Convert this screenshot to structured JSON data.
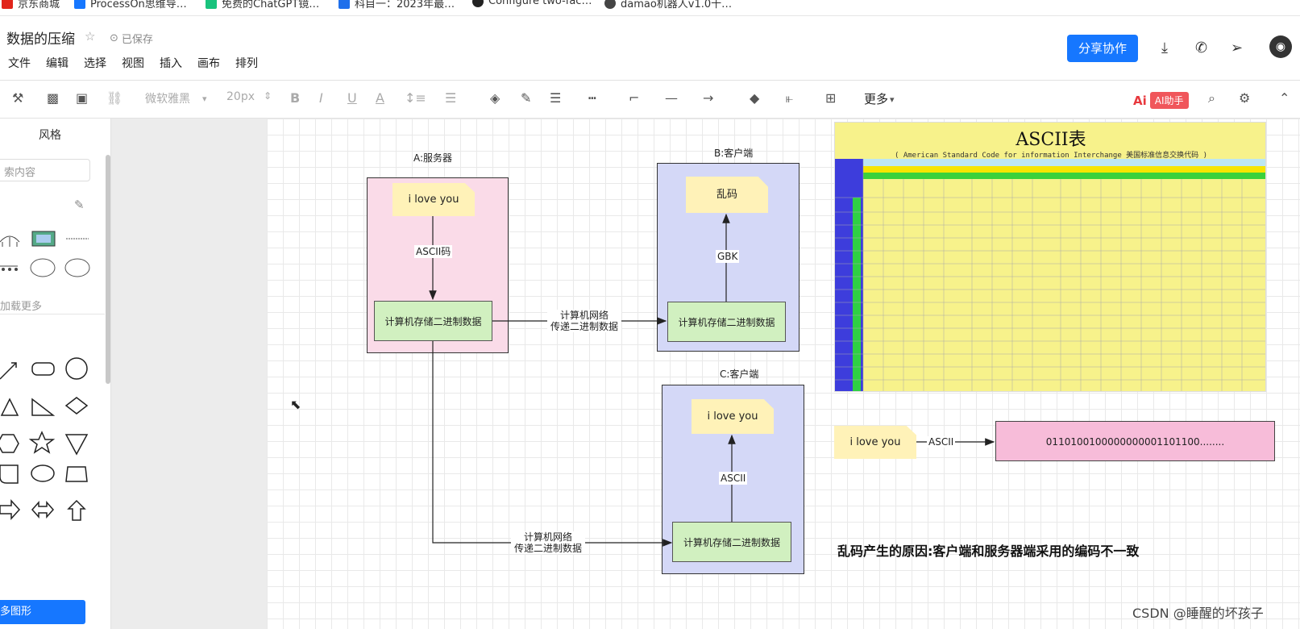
{
  "bookmarks": [
    {
      "label": "京东商城",
      "color": "#e1251b"
    },
    {
      "label": "ProcessOn思维导…",
      "color": "#1677ff"
    },
    {
      "label": "免费的ChatGPT镜…",
      "color": "#19c37d"
    },
    {
      "label": "科目一：2023年最…",
      "color": "#1f6feb"
    },
    {
      "label": "Configure two-fac…",
      "color": "#222222"
    },
    {
      "label": "damao机器人v1.0十…",
      "color": "#444444"
    }
  ],
  "header": {
    "title": "数据的压缩",
    "saved": "已保存",
    "menu": [
      "文件",
      "编辑",
      "选择",
      "视图",
      "插入",
      "画布",
      "排列"
    ],
    "share": "分享协作"
  },
  "toolbar": {
    "font": "微软雅黑",
    "size": "20px",
    "more": "更多",
    "ai_logo": "Ai",
    "ai": "AI助手"
  },
  "sidebar": {
    "title": "风格",
    "search_placeholder": "索内容",
    "load_more": "加载更多",
    "more_shapes": "多图形"
  },
  "diagram": {
    "server_label": "A:服务器",
    "client_b_label": "B:客户端",
    "client_c_label": "C:客户端",
    "note_a": "i love you",
    "note_b": "乱码",
    "note_c": "i love you",
    "ascii_code": "ASCII码",
    "gbk": "GBK",
    "ascii_c": "ASCII",
    "storage_a": "计算机存储二进制数据",
    "storage_b": "计算机存储二进制数据",
    "storage_c": "计算机存储二进制数据",
    "net_b_line1": "计算机网络",
    "net_b_line2": "传递二进制数据",
    "net_c_line1": "计算机网络",
    "net_c_line2": "传递二进制数据",
    "note_d": "i love you",
    "ascii_d": "ASCII",
    "binary": "0110100100000000001101100........",
    "reason": "乱码产生的原因:客户端和服务器端采用的编码不一致"
  },
  "ascii_table": {
    "title": "ASCII表",
    "subtitle": "( American Standard Code for information Interchange  美国标准信息交换代码 )"
  },
  "watermark": "CSDN @睡醒的坏孩子"
}
